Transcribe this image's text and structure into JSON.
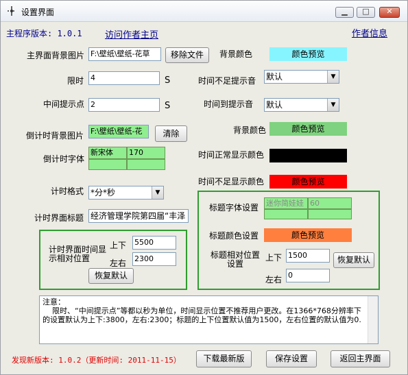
{
  "window": {
    "title": "设置界面",
    "controls": {
      "minimize": "▁",
      "maximize": "□",
      "close": "✕"
    }
  },
  "header": {
    "version": "主程序版本: 1.0.1",
    "visit_author": "访问作者主页",
    "author_info": "作者信息"
  },
  "main_bg": {
    "label": "主界面背景图片",
    "path": "F:\\壁纸\\壁纸-花草",
    "remove_button": "移除文件"
  },
  "time_limit": {
    "label": "限时",
    "value": "4",
    "unit": "S"
  },
  "mid_point": {
    "label": "中间提示点",
    "value": "2",
    "unit": "S"
  },
  "countdown_bg": {
    "label": "倒计时背景图片",
    "path": "F:\\壁纸\\壁纸-花",
    "clear_button": "清除"
  },
  "countdown_font": {
    "label": "倒计时字体",
    "name": "新宋体",
    "size": "170"
  },
  "time_format": {
    "label": "计时格式",
    "value": "*分*秒"
  },
  "timer_title": {
    "label": "计时界面标题",
    "value": "经济管理学院第四届“丰泽"
  },
  "timer_position": {
    "label": "计时界面时间显示相对位置",
    "vertical_label": "上下",
    "vertical": "5500",
    "horizontal_label": "左右",
    "horizontal": "2300",
    "reset": "恢复默认"
  },
  "right": {
    "bg_color": {
      "label": "背景颜色",
      "preview": "颜色预览",
      "color": "#87f5ff"
    },
    "time_short_sound": {
      "label": "时间不足提示音",
      "value": "默认"
    },
    "time_up_sound": {
      "label": "时间到提示音",
      "value": "默认"
    },
    "countdown_bg_color": {
      "label": "背景颜色",
      "preview": "颜色预览",
      "color": "#7fd27f"
    },
    "normal_color": {
      "label": "时间正常显示颜色",
      "color": "#000000"
    },
    "short_color": {
      "label": "时间不足显示颜色",
      "preview": "颜色预览",
      "color": "#ff0000"
    }
  },
  "title_group": {
    "font_label": "标题字体设置",
    "font_name": "迷你简娃娃",
    "font_size": "60",
    "color_label": "标题颜色设置",
    "color_preview": "颜色预览",
    "color": "#ff7f3f",
    "position_label": "标题相对位置设置",
    "vertical_label": "上下",
    "vertical": "1500",
    "horizontal_label": "左右",
    "horizontal": "0",
    "reset": "恢复默认"
  },
  "notes": {
    "text": "注意：\n    限时、“中间提示点”等都以秒为单位，时间显示位置不推荐用户更改。在1366*768分辨率下的设置默认为上下:3800，左右:2300；标题的上下位置默认值为1500，左右位置的默认值为0."
  },
  "footer": {
    "new_version": "发现新版本: 1.0.2（更新时间: 2011-11-15）",
    "download": "下载最新版",
    "save": "保存设置",
    "back": "返回主界面"
  }
}
